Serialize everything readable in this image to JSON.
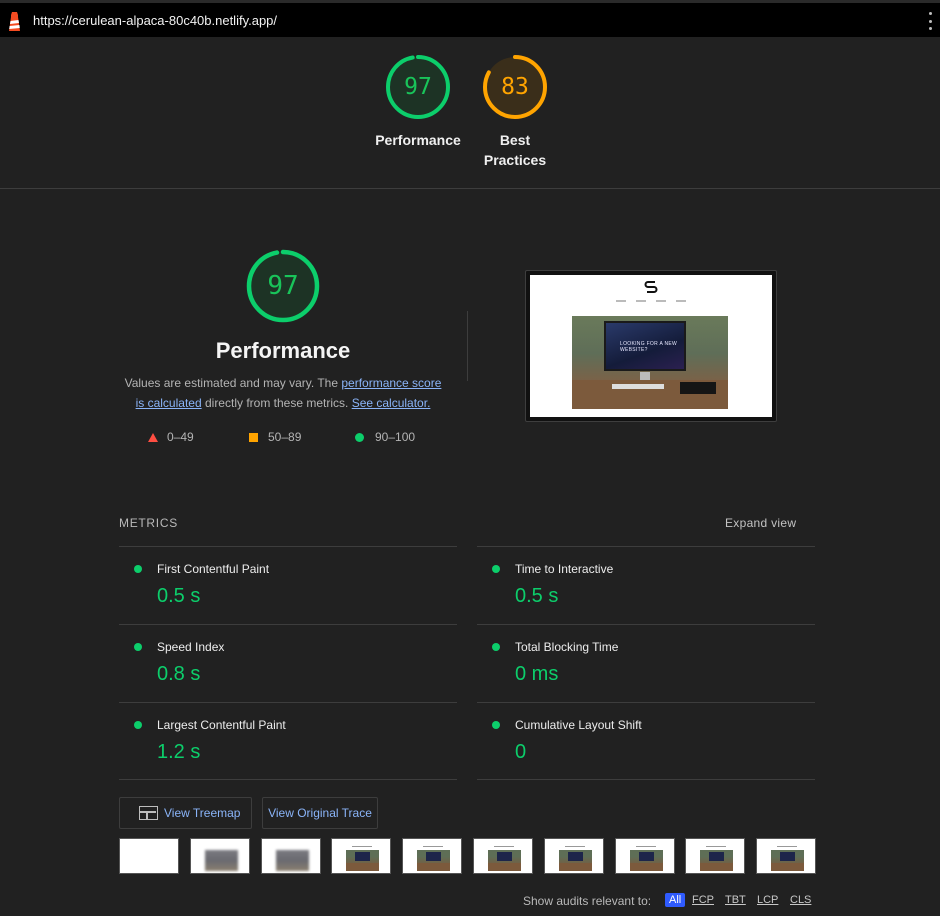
{
  "browser": {
    "url": "https://cerulean-alpaca-80c40b.netlify.app/"
  },
  "top_gauges": [
    {
      "score": "97",
      "label_line1": "Performance",
      "label_line2": "",
      "color": "#0cce6b",
      "fraction": 0.97
    },
    {
      "score": "83",
      "label_line1": "Best",
      "label_line2": "Practices",
      "color": "#ffa400",
      "fraction": 0.83
    }
  ],
  "performance": {
    "score": "97",
    "fraction": 0.97,
    "title": "Performance",
    "desc_1": "Values are estimated and may vary. The ",
    "link_score": "performance score",
    "link_calc": "is calculated",
    "desc_2": " directly from these metrics. ",
    "link_calculator": "See calculator."
  },
  "legend": [
    {
      "range": "0–49",
      "shape": "triangle",
      "color": "#ff4e42"
    },
    {
      "range": "50–89",
      "shape": "square",
      "color": "#ffa400"
    },
    {
      "range": "90–100",
      "shape": "circle",
      "color": "#0cce6b"
    }
  ],
  "screenshot": {
    "hero_text": "LOOKING FOR A NEW WEBSITE?"
  },
  "metrics": {
    "header": "METRICS",
    "expand": "Expand view",
    "items": [
      {
        "name": "First Contentful Paint",
        "value": "0.5 s"
      },
      {
        "name": "Time to Interactive",
        "value": "0.5 s"
      },
      {
        "name": "Speed Index",
        "value": "0.8 s"
      },
      {
        "name": "Total Blocking Time",
        "value": "0 ms"
      },
      {
        "name": "Largest Contentful Paint",
        "value": "1.2 s"
      },
      {
        "name": "Cumulative Layout Shift",
        "value": "0"
      }
    ]
  },
  "buttons": {
    "treemap": "View Treemap",
    "trace": "View Original Trace"
  },
  "filmstrip": {
    "frames": [
      "blank",
      "blurred",
      "blurred",
      "full",
      "full",
      "full",
      "full",
      "full",
      "full",
      "full"
    ]
  },
  "audits": {
    "label": "Show audits relevant to:",
    "chips": [
      "All",
      "FCP",
      "TBT",
      "LCP",
      "CLS"
    ],
    "active": "All"
  }
}
